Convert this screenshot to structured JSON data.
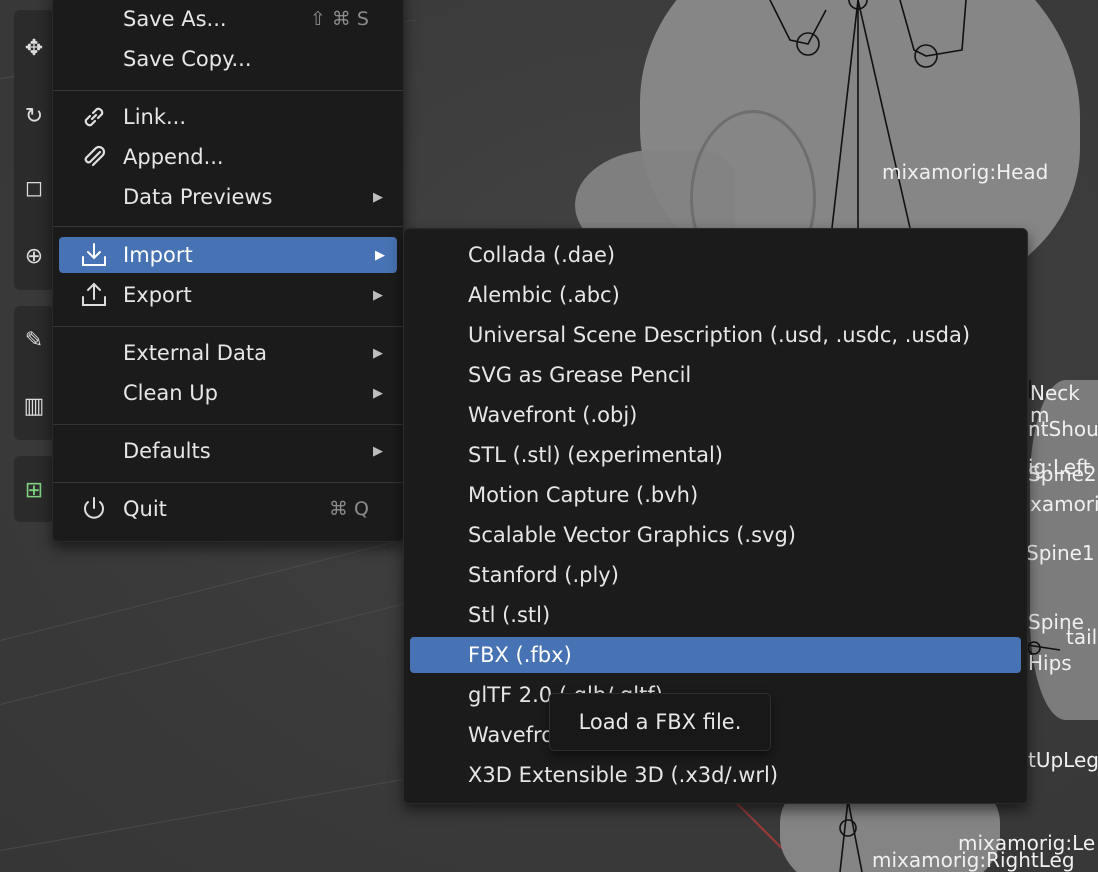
{
  "file_menu": {
    "items": [
      {
        "label": "Save As...",
        "shortcut": "⇧ ⌘ S",
        "icon": ""
      },
      {
        "label": "Save Copy...",
        "shortcut": "",
        "icon": ""
      },
      {
        "label": "Link...",
        "shortcut": "",
        "icon": "link-icon"
      },
      {
        "label": "Append...",
        "shortcut": "",
        "icon": "paperclip-icon"
      },
      {
        "label": "Data Previews",
        "shortcut": "",
        "icon": "",
        "submenu": true
      },
      {
        "label": "Import",
        "shortcut": "",
        "icon": "import-icon",
        "submenu": true,
        "active": true
      },
      {
        "label": "Export",
        "shortcut": "",
        "icon": "export-icon",
        "submenu": true
      },
      {
        "label": "External Data",
        "shortcut": "",
        "icon": "",
        "submenu": true
      },
      {
        "label": "Clean Up",
        "shortcut": "",
        "icon": "",
        "submenu": true
      },
      {
        "label": "Defaults",
        "shortcut": "",
        "icon": "",
        "submenu": true
      },
      {
        "label": "Quit",
        "shortcut": "⌘ Q",
        "icon": "power-icon"
      }
    ]
  },
  "import_menu": {
    "items": [
      "Collada (.dae)",
      "Alembic (.abc)",
      "Universal Scene Description (.usd, .usdc, .usda)",
      "SVG as Grease Pencil",
      "Wavefront (.obj)",
      "STL (.stl) (experimental)",
      "Motion Capture (.bvh)",
      "Scalable Vector Graphics (.svg)",
      "Stanford (.ply)",
      "Stl (.stl)",
      "FBX (.fbx)",
      "glTF 2.0 (.glb/.gltf)",
      "Wavefront",
      "X3D Extensible 3D (.x3d/.wrl)"
    ],
    "active_index": 10
  },
  "tooltip": {
    "text": "Load a FBX file."
  },
  "bone_labels": [
    "mixamorig:Head",
    "Neck",
    "m",
    "ntShoul",
    "ig:Left",
    "Spine2",
    "xamorig",
    "Spine1",
    "Spine",
    "tail",
    "Hips",
    "tUpLeg",
    "mixamorig:Le",
    "mixamorig:RightLeg"
  ],
  "colors": {
    "accent": "#4772b3",
    "menu_bg": "#1b1b1b",
    "viewport_bg": "#3d3d3d"
  }
}
